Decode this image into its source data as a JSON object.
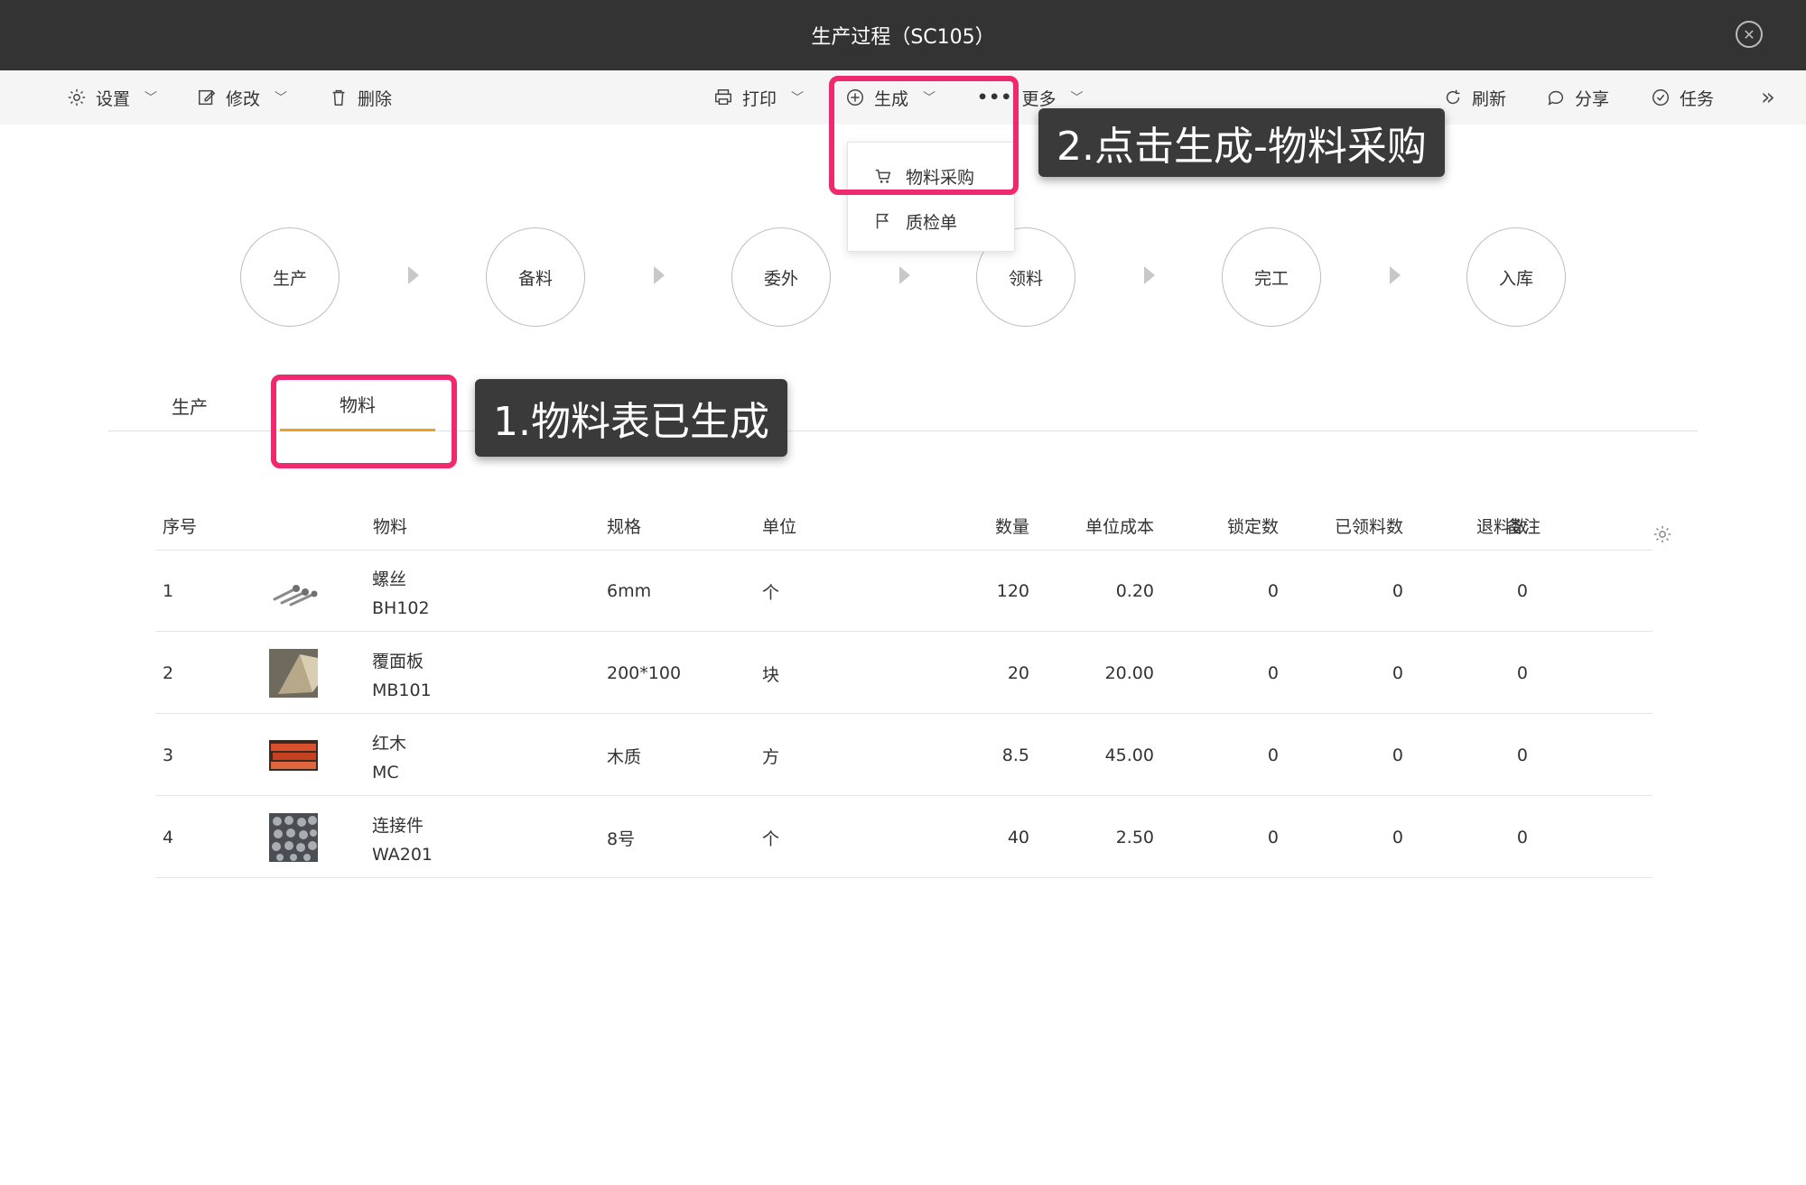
{
  "window": {
    "title": "生产过程（SC105）"
  },
  "toolbar": {
    "settings": "设置",
    "edit": "修改",
    "delete": "删除",
    "print": "打印",
    "generate": "生成",
    "more": "更多",
    "refresh": "刷新",
    "share": "分享",
    "task": "任务",
    "expand": "»"
  },
  "dropdown": {
    "items": [
      {
        "label": "物料采购",
        "icon": "cart-icon"
      },
      {
        "label": "质检单",
        "icon": "flag-icon"
      }
    ]
  },
  "steps": [
    "生产",
    "备料",
    "委外",
    "领料",
    "完工",
    "入库"
  ],
  "tabs": [
    {
      "label": "生产",
      "active": false
    },
    {
      "label": "物料",
      "active": true
    }
  ],
  "table": {
    "headers": [
      "序号",
      "物料",
      "规格",
      "单位",
      "数量",
      "单位成本",
      "锁定数",
      "已领料数",
      "退料数",
      "备注"
    ],
    "rows": [
      {
        "no": "1",
        "name": "螺丝",
        "code": "BH102",
        "spec": "6mm",
        "unit": "个",
        "qty": "120",
        "cost": "0.20",
        "locked": "0",
        "picked": "0",
        "returned": "0",
        "note": ""
      },
      {
        "no": "2",
        "name": "覆面板",
        "code": "MB101",
        "spec": "200*100",
        "unit": "块",
        "qty": "20",
        "cost": "20.00",
        "locked": "0",
        "picked": "0",
        "returned": "0",
        "note": ""
      },
      {
        "no": "3",
        "name": "红木",
        "code": "MC",
        "spec": "木质",
        "unit": "方",
        "qty": "8.5",
        "cost": "45.00",
        "locked": "0",
        "picked": "0",
        "returned": "0",
        "note": ""
      },
      {
        "no": "4",
        "name": "连接件",
        "code": "WA201",
        "spec": "8号",
        "unit": "个",
        "qty": "40",
        "cost": "2.50",
        "locked": "0",
        "picked": "0",
        "returned": "0",
        "note": ""
      }
    ]
  },
  "annotations": {
    "callout1": "1.物料表已生成",
    "callout2": "2.点击生成-物料采购"
  },
  "colors": {
    "highlight": "#f0286e",
    "tab_underline": "#f0a020",
    "titlebar": "#333333"
  }
}
